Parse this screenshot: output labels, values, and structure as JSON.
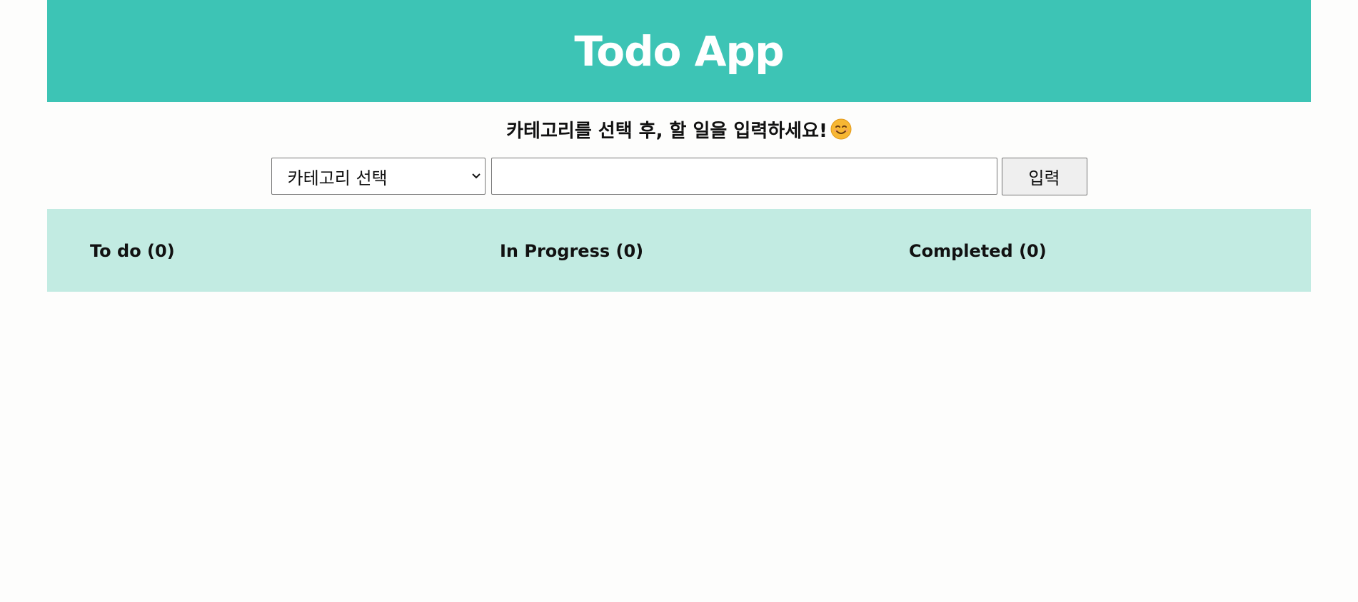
{
  "header": {
    "title": "Todo App"
  },
  "prompt": {
    "text": "카테고리를 선택 후, 할 일을 입력하세요!",
    "emoji_icon": "smiling-face-icon"
  },
  "form": {
    "category_select": {
      "selected": "카테고리 선택"
    },
    "todo_input": {
      "value": "",
      "placeholder": ""
    },
    "submit_label": "입력"
  },
  "board": {
    "columns": [
      {
        "label": "To do (0)"
      },
      {
        "label": "In Progress (0)"
      },
      {
        "label": "Completed (0)"
      }
    ]
  },
  "colors": {
    "header_bg": "#3dc4b5",
    "board_bg": "#c2ebe2",
    "page_bg": "#fdfdfc"
  }
}
